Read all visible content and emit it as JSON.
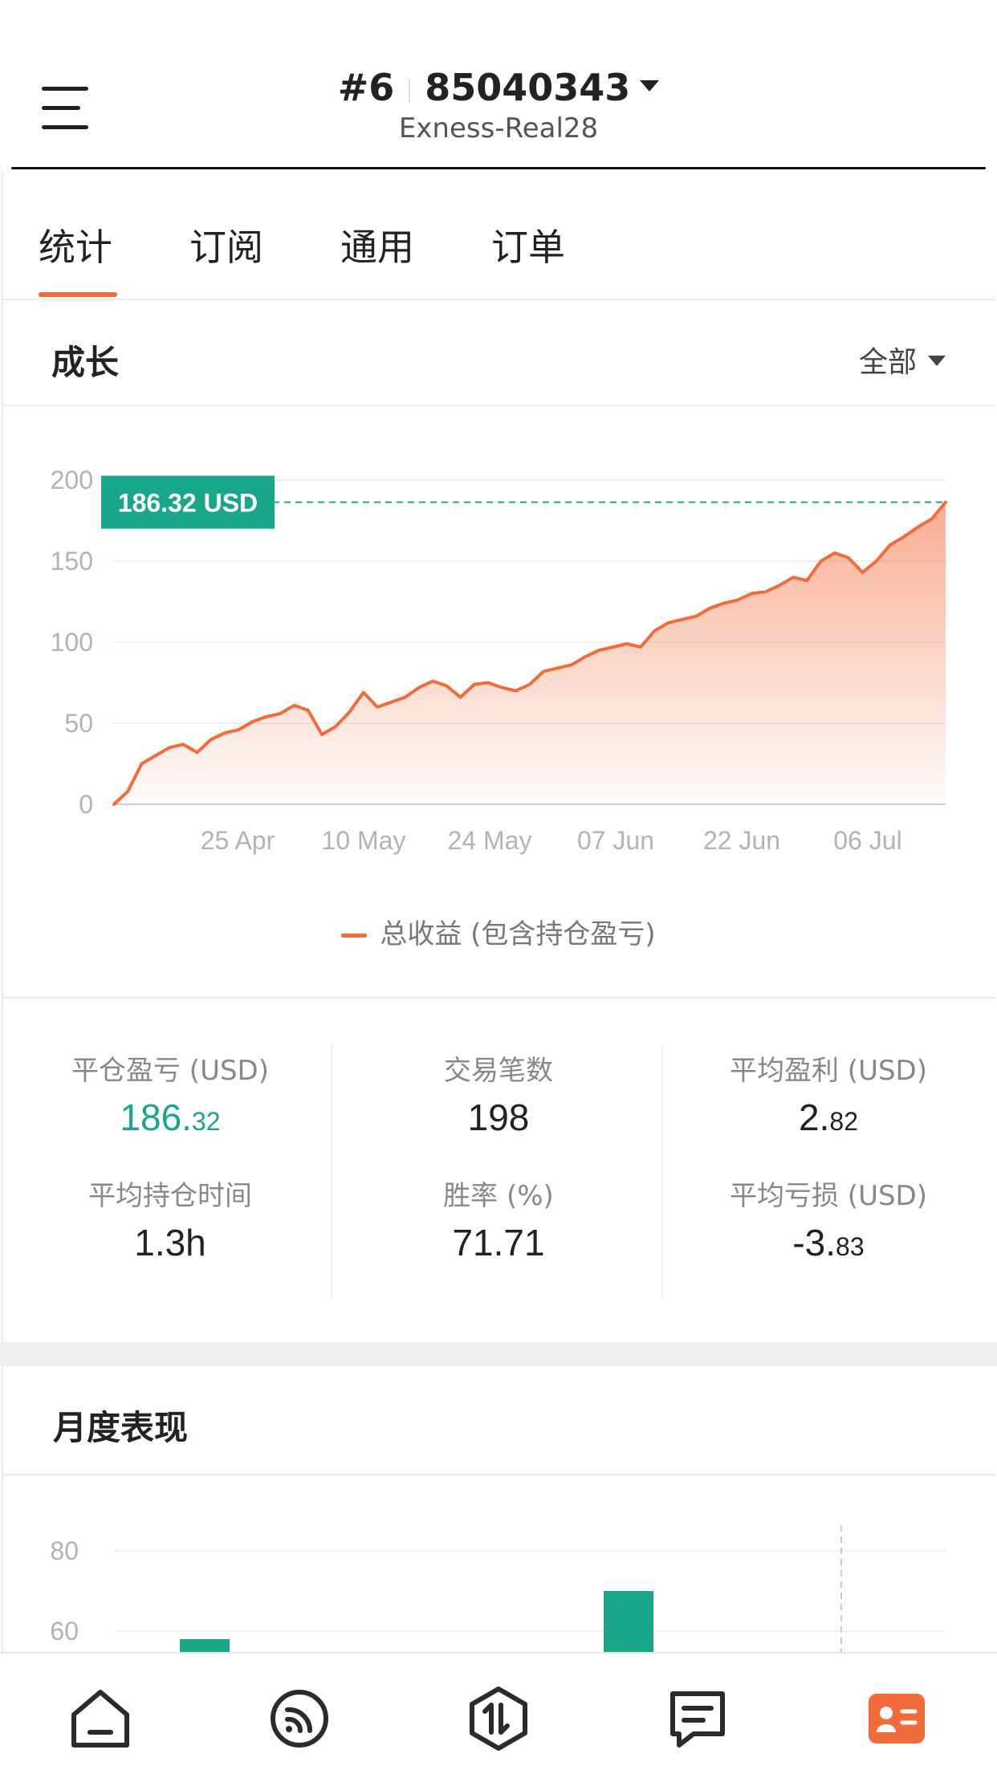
{
  "header": {
    "account_index": "#6",
    "account_number": "85040343",
    "server": "Exness-Real28"
  },
  "tabs": [
    {
      "label": "统计",
      "active": true
    },
    {
      "label": "订阅",
      "active": false
    },
    {
      "label": "通用",
      "active": false
    },
    {
      "label": "订单",
      "active": false
    }
  ],
  "growth": {
    "title": "成长",
    "filter": "全部",
    "legend": "总收益 (包含持仓盈亏)"
  },
  "chart_data": [
    {
      "type": "area",
      "y_ticks": [
        "200",
        "150",
        "100",
        "50",
        "0"
      ],
      "ylim": [
        0,
        200
      ],
      "x_ticks": [
        "25 Apr",
        "10 May",
        "24 May",
        "07 Jun",
        "22 Jun",
        "06 Jul"
      ],
      "last_value_label": "186.32 USD",
      "series": [
        {
          "name": "总收益 (包含持仓盈亏)",
          "color": "#f26c3b",
          "values": [
            0,
            8,
            25,
            30,
            35,
            37,
            32,
            40,
            44,
            46,
            51,
            54,
            56,
            61,
            58,
            43,
            48,
            57,
            69,
            60,
            63,
            66,
            72,
            76,
            73,
            66,
            74,
            75,
            72,
            70,
            74,
            82,
            84,
            86,
            91,
            95,
            97,
            99,
            97,
            107,
            112,
            114,
            116,
            121,
            124,
            126,
            130,
            131,
            135,
            140,
            138,
            150,
            155,
            152,
            143,
            150,
            160,
            165,
            171,
            176,
            186.32
          ]
        }
      ]
    },
    {
      "type": "bar",
      "y_ticks": [
        "80",
        "60"
      ],
      "series": [
        {
          "color": "#1aa689",
          "values": [
            58,
            70
          ]
        }
      ]
    }
  ],
  "stats": [
    {
      "label": "平仓盈亏 (USD)",
      "int": "186.",
      "dec": "32",
      "color": "#1aa689"
    },
    {
      "label": "交易笔数",
      "int": "198",
      "dec": ""
    },
    {
      "label": "平均盈利 (USD)",
      "int": "2.",
      "dec": "82"
    },
    {
      "label": "平均持仓时间",
      "int": "1.3h",
      "dec": ""
    },
    {
      "label": "胜率 (%)",
      "int": "71.71",
      "dec": ""
    },
    {
      "label": "平均亏损 (USD)",
      "int": "-3.",
      "dec": "83"
    }
  ],
  "monthly": {
    "title": "月度表现"
  },
  "bottom_nav": [
    {
      "icon": "home-icon"
    },
    {
      "icon": "signal-feed-icon"
    },
    {
      "icon": "trade-icon"
    },
    {
      "icon": "messages-icon"
    },
    {
      "icon": "account-card-icon",
      "active": true
    }
  ],
  "colors": {
    "accent": "#f26c3b",
    "positive": "#1aa689"
  }
}
